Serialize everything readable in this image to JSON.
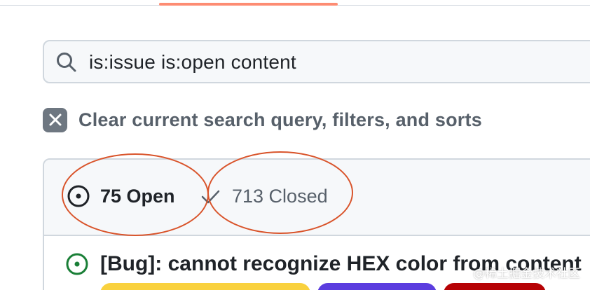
{
  "search": {
    "query": "is:issue is:open content"
  },
  "clear_filters": {
    "label": "Clear current search query, filters, and sorts"
  },
  "states": {
    "open_label": "75 Open",
    "closed_label": "713 Closed"
  },
  "issue": {
    "title": "[Bug]: cannot recognize HEX color from content"
  },
  "watermark": "@稀土掘金技术社区",
  "colors": {
    "accent_tab": "#fd8c73",
    "annotation": "#d9542b",
    "open_icon": "#1a7f37",
    "label_yellow": "#f9d13e",
    "label_purple": "#5b3ddf",
    "label_red": "#b60205"
  }
}
